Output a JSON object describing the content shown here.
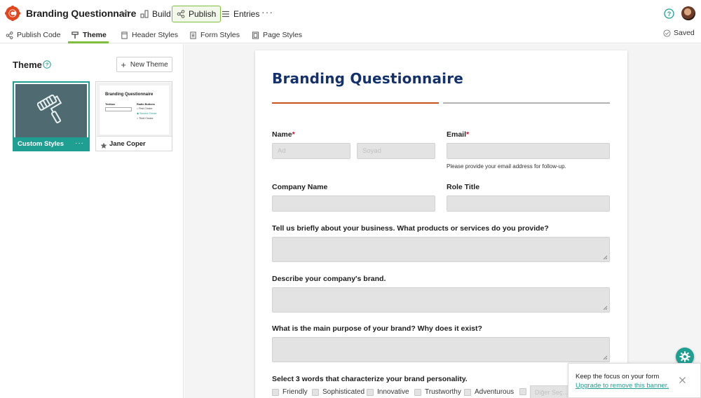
{
  "app": {
    "title": "Branding Questionnaire",
    "nav": [
      {
        "label": "Build"
      },
      {
        "label": "Publish"
      },
      {
        "label": "Entries"
      }
    ],
    "more": "···"
  },
  "toolbar": {
    "items": [
      {
        "label": "Publish Code"
      },
      {
        "label": "Theme"
      },
      {
        "label": "Header Styles"
      },
      {
        "label": "Form Styles"
      },
      {
        "label": "Page Styles"
      }
    ],
    "status": "Saved"
  },
  "theme_panel": {
    "title": "Theme",
    "new_button": "New Theme",
    "cards": [
      {
        "name": "Custom Styles",
        "selected": true,
        "menu": "···"
      },
      {
        "name": "Jane Coper",
        "starred": true
      }
    ],
    "jane_preview": {
      "title": "Branding Questionnaire",
      "textbox_label": "Textbox",
      "radio_label": "Radio Buttons",
      "options": [
        "First Choice",
        "Second Choice",
        "Third Choice"
      ]
    }
  },
  "form": {
    "title": "Branding Questionnaire",
    "name": {
      "label": "Name",
      "required": "*",
      "first_placeholder": "Ad",
      "last_placeholder": "Soyad"
    },
    "email": {
      "label": "Email",
      "required": "*",
      "hint": "Please provide your email address for follow-up."
    },
    "company": {
      "label": "Company Name"
    },
    "role": {
      "label": "Role Title"
    },
    "q_business": {
      "label": "Tell us briefly about your business. What products or services do you provide?"
    },
    "q_brand": {
      "label": "Describe your company's brand."
    },
    "q_purpose": {
      "label": "What is the main purpose of your brand? Why does it exist?"
    },
    "q_words": {
      "label": "Select 3 words that characterize your brand personality.",
      "options": [
        "Friendly",
        "Sophisticated",
        "Innovative",
        "Trustworthy",
        "Adventurous"
      ],
      "other_placeholder": "Diğer Seç..."
    }
  },
  "banner": {
    "title": "Keep the focus on your form",
    "link": "Upgrade to remove this banner."
  },
  "colors": {
    "accent_green": "#7fbd3f",
    "teal": "#1f9e92",
    "form_title": "#13316a",
    "rule_orange": "#c8541c"
  }
}
